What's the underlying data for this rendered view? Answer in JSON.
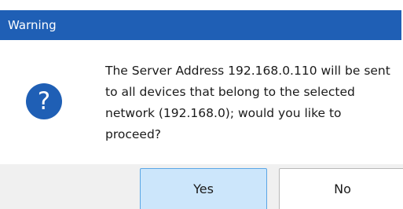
{
  "dialog": {
    "title": "Warning",
    "icon": "question-icon",
    "message": "The Server Address 192.168.0.110 will be sent to all devices that belong to the selected network (192.168.0); would you like to proceed?",
    "buttons": {
      "yes_label": "Yes",
      "no_label": "No"
    }
  },
  "colors": {
    "titlebar": "#1f5fb5",
    "icon": "#1f5fb5",
    "primary_button": "#cce6fb",
    "footer": "#f0f0f0"
  }
}
